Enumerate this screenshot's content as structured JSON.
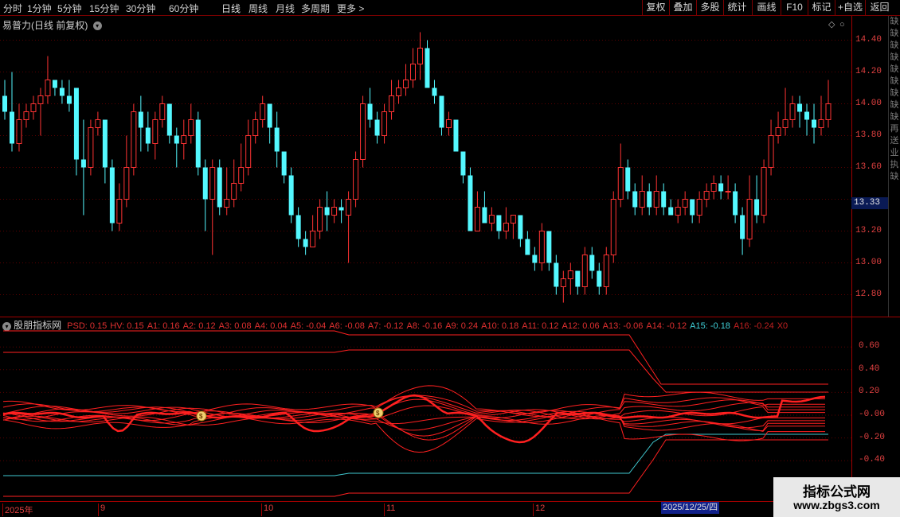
{
  "toolbar": {
    "periods": [
      "分时",
      "1分钟",
      "5分钟",
      "15分钟",
      "30分钟",
      "60分钟",
      "日线",
      "周线",
      "月线",
      "多周期",
      "更多 >"
    ],
    "active_period": "日线",
    "right_buttons": [
      "复权",
      "叠加",
      "多股",
      "统计",
      "画线",
      "F10",
      "标记",
      "+自选",
      "返回"
    ]
  },
  "main": {
    "title": "易普力(日线 前复权)",
    "current_price": "13.33"
  },
  "price_axis": [
    "14.40",
    "14.20",
    "14.00",
    "13.80",
    "13.60",
    "13.20",
    "13.00",
    "12.80"
  ],
  "side_strip": [
    "缺",
    "缺",
    "缺",
    "缺",
    "缺",
    "缺",
    "缺",
    "缺",
    "缺",
    "再",
    "送",
    "业",
    "执",
    "缺"
  ],
  "indicator": {
    "name": "股朋指标网",
    "values": [
      {
        "text": "PSD: 0.15",
        "color": "#e03030"
      },
      {
        "text": "HV: 0.15",
        "color": "#e03030"
      },
      {
        "text": "A1: 0.16",
        "color": "#e03030"
      },
      {
        "text": "A2: 0.12",
        "color": "#e03030"
      },
      {
        "text": "A3: 0.08",
        "color": "#e03030"
      },
      {
        "text": "A4: 0.04",
        "color": "#e03030"
      },
      {
        "text": "A5: -0.04",
        "color": "#e03030"
      },
      {
        "text": "A6: -0.08",
        "color": "#e03030"
      },
      {
        "text": "A7: -0.12",
        "color": "#e03030"
      },
      {
        "text": "A8: -0.16",
        "color": "#e03030"
      },
      {
        "text": "A9: 0.24",
        "color": "#e03030"
      },
      {
        "text": "A10: 0.18",
        "color": "#e03030"
      },
      {
        "text": "A11: 0.12",
        "color": "#e03030"
      },
      {
        "text": "A12: 0.06",
        "color": "#e03030"
      },
      {
        "text": "A13: -0.06",
        "color": "#e03030"
      },
      {
        "text": "A14: -0.12",
        "color": "#e03030"
      },
      {
        "text": "A15: -0.18",
        "color": "#40d0d8"
      },
      {
        "text": "A16: -0.24",
        "color": "#c02020"
      },
      {
        "text": "X0",
        "color": "#c02020"
      }
    ],
    "axis": [
      "0.60",
      "0.40",
      "0.20",
      "-0.00",
      "-0.20",
      "-0.40"
    ]
  },
  "date_axis": [
    "2025年",
    "9",
    "10",
    "11",
    "12"
  ],
  "date_cursor": "2025/12/25/四",
  "watermark": {
    "title": "指标公式网",
    "url": "www.zbgs3.com"
  },
  "colors": {
    "up": "#ff3333",
    "down": "#54f8ff",
    "line": "#ff2020",
    "cyan_line": "#40c8d0"
  },
  "chart_data": {
    "type": "candlestick",
    "yaxis_ticks": [
      14.4,
      14.2,
      14.0,
      13.8,
      13.6,
      13.2,
      13.0,
      12.8
    ],
    "last_price": 13.33,
    "candles": [
      [
        14.05,
        13.95,
        14.15,
        13.9
      ],
      [
        13.95,
        13.75,
        14.2,
        13.7
      ],
      [
        13.75,
        13.9,
        14.0,
        13.7
      ],
      [
        13.9,
        13.95,
        14.0,
        13.85
      ],
      [
        13.95,
        14.0,
        14.05,
        13.9
      ],
      [
        14.0,
        14.05,
        14.1,
        13.8
      ],
      [
        14.05,
        14.15,
        14.3,
        14.0
      ],
      [
        14.15,
        14.1,
        14.15,
        14.05
      ],
      [
        14.1,
        14.05,
        14.15,
        14.0
      ],
      [
        14.05,
        14.0,
        14.15,
        13.95
      ],
      [
        14.1,
        13.65,
        14.1,
        13.55
      ],
      [
        13.65,
        13.6,
        13.9,
        13.3
      ],
      [
        13.6,
        13.85,
        13.9,
        13.55
      ],
      [
        13.85,
        13.9,
        13.95,
        13.8
      ],
      [
        13.9,
        13.6,
        13.9,
        13.5
      ],
      [
        13.6,
        13.25,
        13.65,
        13.2
      ],
      [
        13.25,
        13.4,
        13.5,
        13.2
      ],
      [
        13.4,
        13.6,
        13.8,
        13.35
      ],
      [
        13.6,
        13.95,
        14.0,
        13.55
      ],
      [
        13.95,
        13.85,
        14.05,
        13.7
      ],
      [
        13.85,
        13.75,
        13.95,
        13.7
      ],
      [
        13.75,
        13.9,
        13.95,
        13.65
      ],
      [
        13.9,
        14.0,
        14.05,
        13.85
      ],
      [
        14.0,
        13.8,
        14.0,
        13.75
      ],
      [
        13.8,
        13.75,
        13.85,
        13.6
      ],
      [
        13.75,
        13.8,
        13.9,
        13.65
      ],
      [
        13.8,
        13.9,
        14.0,
        13.75
      ],
      [
        13.9,
        13.6,
        13.95,
        13.55
      ],
      [
        13.6,
        13.4,
        13.65,
        13.2
      ],
      [
        13.4,
        13.6,
        13.65,
        13.05
      ],
      [
        13.6,
        13.35,
        13.65,
        13.3
      ],
      [
        13.35,
        13.4,
        13.6,
        13.3
      ],
      [
        13.4,
        13.5,
        13.65,
        13.35
      ],
      [
        13.5,
        13.6,
        13.75,
        13.45
      ],
      [
        13.6,
        13.8,
        13.9,
        13.55
      ],
      [
        13.8,
        13.9,
        13.95,
        13.75
      ],
      [
        13.9,
        14.0,
        14.05,
        13.85
      ],
      [
        14.0,
        13.85,
        14.0,
        13.75
      ],
      [
        13.85,
        13.7,
        13.95,
        13.6
      ],
      [
        13.7,
        13.55,
        13.7,
        13.5
      ],
      [
        13.55,
        13.3,
        13.6,
        13.25
      ],
      [
        13.3,
        13.15,
        13.35,
        13.1
      ],
      [
        13.15,
        13.1,
        13.2,
        13.05
      ],
      [
        13.1,
        13.2,
        13.3,
        13.1
      ],
      [
        13.2,
        13.35,
        13.4,
        13.15
      ],
      [
        13.35,
        13.3,
        13.45,
        13.2
      ],
      [
        13.3,
        13.35,
        13.4,
        13.25
      ],
      [
        13.35,
        13.33,
        13.4,
        13.25
      ],
      [
        13.3,
        13.4,
        13.45,
        13.0
      ],
      [
        13.4,
        13.65,
        13.7,
        13.35
      ],
      [
        13.65,
        14.0,
        14.05,
        13.6
      ],
      [
        14.0,
        13.9,
        14.1,
        13.85
      ],
      [
        13.9,
        13.8,
        13.95,
        13.75
      ],
      [
        13.8,
        13.95,
        14.0,
        13.75
      ],
      [
        13.95,
        14.05,
        14.15,
        13.9
      ],
      [
        14.05,
        14.1,
        14.15,
        14.0
      ],
      [
        14.1,
        14.15,
        14.25,
        14.05
      ],
      [
        14.15,
        14.25,
        14.35,
        14.1
      ],
      [
        14.25,
        14.35,
        14.45,
        14.15
      ],
      [
        14.35,
        14.1,
        14.4,
        14.1
      ],
      [
        14.1,
        14.05,
        14.15,
        14.0
      ],
      [
        14.05,
        13.85,
        14.05,
        13.8
      ],
      [
        13.85,
        13.9,
        13.95,
        13.8
      ],
      [
        13.9,
        13.7,
        13.9,
        13.7
      ],
      [
        13.7,
        13.55,
        13.7,
        13.5
      ],
      [
        13.55,
        13.2,
        13.6,
        13.2
      ],
      [
        13.2,
        13.35,
        13.45,
        13.2
      ],
      [
        13.35,
        13.25,
        13.45,
        13.25
      ],
      [
        13.25,
        13.3,
        13.35,
        13.2
      ],
      [
        13.3,
        13.2,
        13.3,
        13.15
      ],
      [
        13.2,
        13.25,
        13.35,
        13.15
      ],
      [
        13.25,
        13.3,
        13.3,
        13.15
      ],
      [
        13.3,
        13.15,
        13.3,
        13.1
      ],
      [
        13.15,
        13.05,
        13.2,
        13.05
      ],
      [
        13.05,
        13.0,
        13.1,
        12.95
      ],
      [
        13.0,
        13.2,
        13.25,
        12.95
      ],
      [
        13.2,
        13.0,
        13.2,
        12.95
      ],
      [
        13.0,
        12.85,
        13.05,
        12.8
      ],
      [
        12.85,
        12.9,
        12.95,
        12.75
      ],
      [
        12.9,
        12.95,
        13.0,
        12.8
      ],
      [
        12.95,
        12.85,
        12.95,
        12.8
      ],
      [
        12.85,
        13.05,
        13.1,
        12.8
      ],
      [
        13.05,
        12.95,
        13.1,
        12.9
      ],
      [
        12.95,
        12.85,
        13.0,
        12.8
      ],
      [
        12.85,
        13.05,
        13.1,
        12.8
      ],
      [
        13.05,
        13.4,
        13.45,
        13.0
      ],
      [
        13.4,
        13.6,
        13.75,
        13.35
      ],
      [
        13.6,
        13.45,
        13.65,
        13.4
      ],
      [
        13.45,
        13.35,
        13.5,
        13.3
      ],
      [
        13.35,
        13.45,
        13.55,
        13.3
      ],
      [
        13.45,
        13.35,
        13.5,
        13.3
      ],
      [
        13.35,
        13.45,
        13.55,
        13.3
      ],
      [
        13.45,
        13.35,
        13.5,
        13.3
      ],
      [
        13.35,
        13.3,
        13.4,
        13.3
      ],
      [
        13.3,
        13.35,
        13.4,
        13.25
      ],
      [
        13.35,
        13.4,
        13.45,
        13.3
      ],
      [
        13.4,
        13.3,
        13.4,
        13.25
      ],
      [
        13.3,
        13.4,
        13.45,
        13.25
      ],
      [
        13.4,
        13.45,
        13.5,
        13.35
      ],
      [
        13.45,
        13.5,
        13.55,
        13.4
      ],
      [
        13.5,
        13.45,
        13.55,
        13.4
      ],
      [
        13.45,
        13.45,
        13.55,
        13.4
      ],
      [
        13.45,
        13.3,
        13.5,
        13.25
      ],
      [
        13.3,
        13.15,
        13.35,
        13.05
      ],
      [
        13.15,
        13.4,
        13.55,
        13.1
      ],
      [
        13.4,
        13.3,
        13.55,
        13.25
      ],
      [
        13.3,
        13.6,
        13.65,
        13.25
      ],
      [
        13.6,
        13.8,
        13.9,
        13.55
      ],
      [
        13.8,
        13.85,
        13.95,
        13.75
      ],
      [
        13.85,
        13.9,
        14.1,
        13.8
      ],
      [
        13.9,
        14.0,
        14.05,
        13.85
      ],
      [
        14.0,
        13.95,
        14.05,
        13.85
      ],
      [
        13.95,
        13.9,
        14.0,
        13.8
      ],
      [
        13.9,
        13.85,
        14.0,
        13.75
      ],
      [
        13.85,
        13.9,
        14.05,
        13.8
      ],
      [
        13.9,
        14.0,
        14.15,
        13.85
      ]
    ]
  }
}
